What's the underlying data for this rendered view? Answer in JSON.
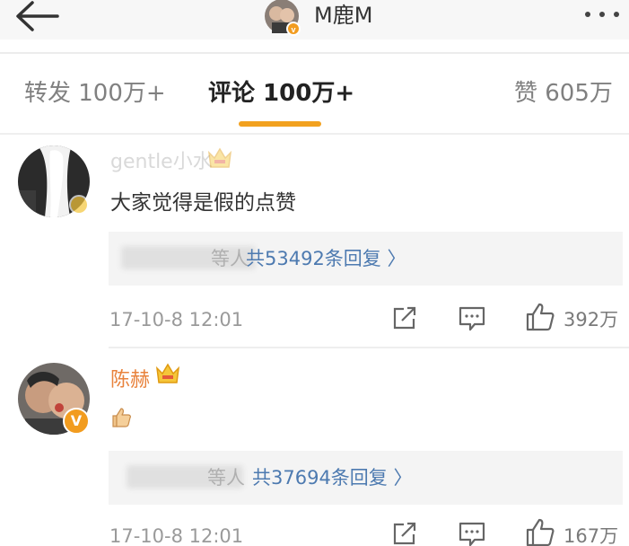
{
  "header": {
    "user_name": "M鹿M",
    "back_icon": "back-arrow-icon",
    "more_icon": "more-dots-icon"
  },
  "tabs": [
    {
      "label": "转发 100万+",
      "active": false
    },
    {
      "label": "评论 100万+",
      "active": true
    },
    {
      "label": "赞 605万",
      "active": false
    }
  ],
  "colors": {
    "accent": "#f2a11f",
    "vip_name": "#e8823c",
    "link": "#4d7ab0",
    "verified_badge": "#f29c1f"
  },
  "comments": [
    {
      "user_name": "gentle小水",
      "text": "大家觉得是假的点赞",
      "reply_names": "等人",
      "reply_count": "共53492条回复 〉",
      "time": "17-10-8 12:01",
      "likes": "392万"
    },
    {
      "user_name": "陈赫",
      "text_emoji": "thumbs-up-emoji",
      "reply_names": "等人",
      "reply_count": "共37694条回复 〉",
      "time": "17-10-8 12:01",
      "likes": "167万"
    }
  ]
}
